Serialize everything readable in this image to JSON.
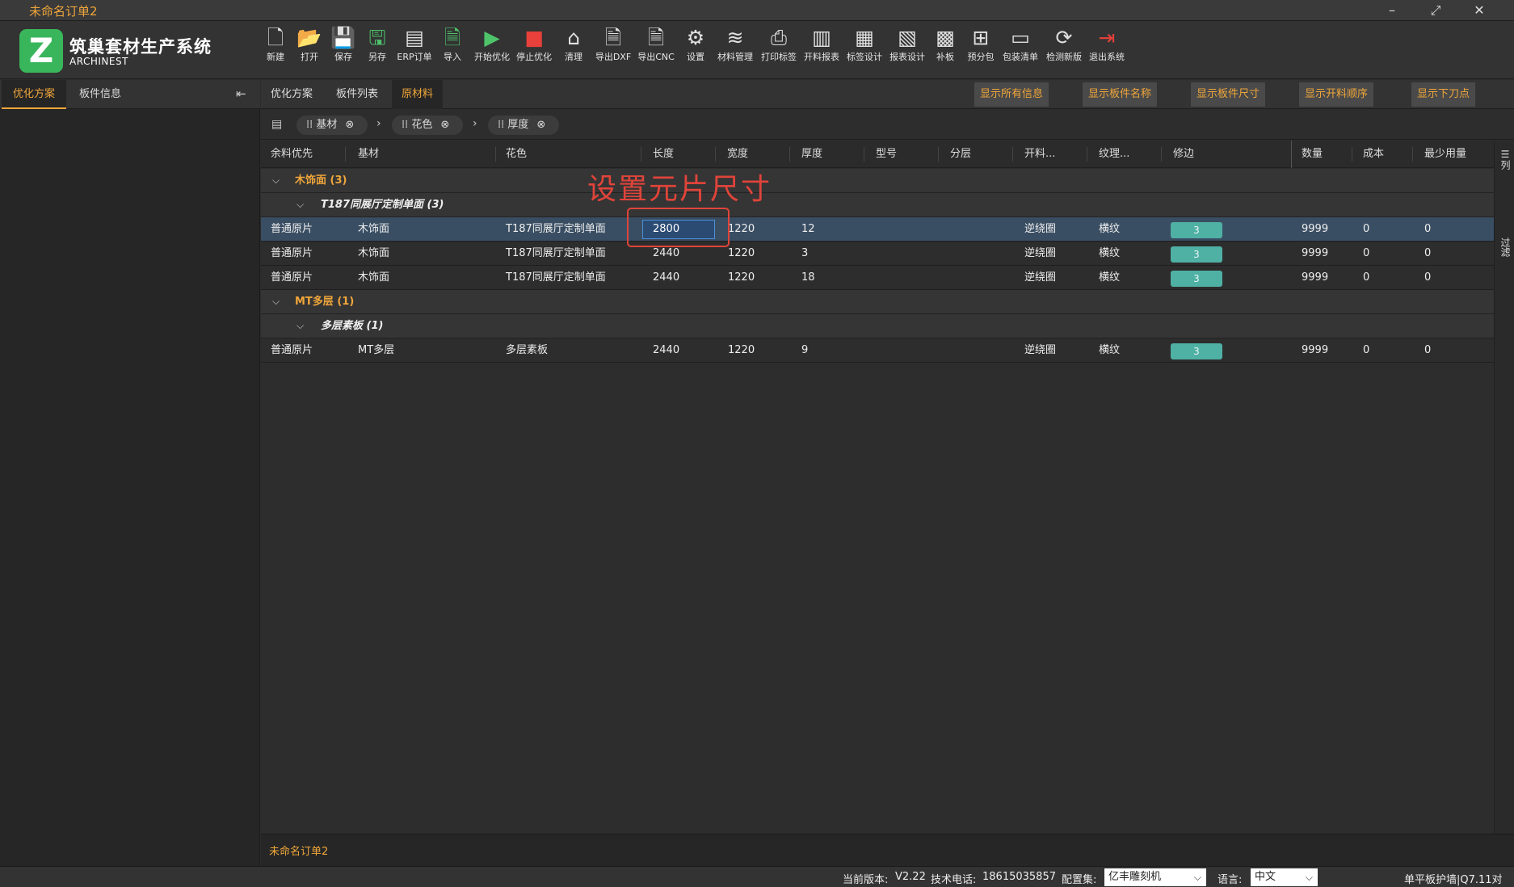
{
  "window": {
    "title": "未命名订单2",
    "minimize_glyph": "–",
    "maximize_glyph": "⤢",
    "close_glyph": "✕"
  },
  "app": {
    "logo_letter": "Z",
    "name": "筑巢套材生产系统",
    "subtitle": "ARCHINEST",
    "brand_color": "#39b65b",
    "accent_color": "#f0a63a"
  },
  "toolbar": [
    {
      "label": "新建",
      "icon": "new-file-icon"
    },
    {
      "label": "打开",
      "icon": "open-folder-icon"
    },
    {
      "label": "保存",
      "icon": "save-icon"
    },
    {
      "label": "另存",
      "icon": "save-as-icon"
    },
    {
      "label": "ERP订单",
      "icon": "erp-order-icon"
    },
    {
      "label": "导入",
      "icon": "import-xml-icon"
    },
    {
      "label": "开始优化",
      "icon": "play-icon"
    },
    {
      "label": "停止优化",
      "icon": "stop-icon"
    },
    {
      "label": "清理",
      "icon": "broom-icon"
    },
    {
      "label": "导出DXF",
      "icon": "export-dxf-icon"
    },
    {
      "label": "导出CNC",
      "icon": "export-cnc-icon"
    },
    {
      "label": "设置",
      "icon": "gear-icon"
    },
    {
      "label": "材料管理",
      "icon": "layers-icon"
    },
    {
      "label": "打印标签",
      "icon": "printer-icon"
    },
    {
      "label": "开料报表",
      "icon": "report-chart-icon"
    },
    {
      "label": "标签设计",
      "icon": "barcode-icon"
    },
    {
      "label": "报表设计",
      "icon": "report-design-icon"
    },
    {
      "label": "补板",
      "icon": "patch-board-icon"
    },
    {
      "label": "预分包",
      "icon": "package-tree-icon"
    },
    {
      "label": "包装清单",
      "icon": "packing-list-icon"
    },
    {
      "label": "检测新版",
      "icon": "update-check-icon"
    },
    {
      "label": "退出系统",
      "icon": "exit-icon"
    }
  ],
  "left_tabs": [
    "优化方案",
    "板件信息"
  ],
  "collapse_glyph": "⇤",
  "right_tabs": [
    "优化方案",
    "板件列表",
    "原材料"
  ],
  "show_buttons": [
    "显示所有信息",
    "显示板件名称",
    "显示板件尺寸",
    "显示开料顺序",
    "显示下刀点"
  ],
  "group_by": [
    "基材",
    "花色",
    "厚度"
  ],
  "columns": [
    "余料优先",
    "基材",
    "花色",
    "长度",
    "宽度",
    "厚度",
    "型号",
    "分层",
    "开料...",
    "纹理...",
    "修边",
    "数量",
    "成本",
    "最少用量"
  ],
  "groups": [
    {
      "label": "木饰面 (3)",
      "sub": "T187同展厅定制单面 (3)"
    },
    {
      "label": "MT多层 (1)",
      "sub": "多层素板 (1)"
    }
  ],
  "rows": [
    {
      "priority": "普通原片",
      "base": "木饰面",
      "color": "T187同展厅定制单面",
      "length": "2800",
      "width": "1220",
      "thickness": "12",
      "model": "",
      "layer": "",
      "cut": "逆绕圈",
      "grain": "横纹",
      "trim": "3",
      "qty": "9999",
      "cost": "0",
      "min": "0"
    },
    {
      "priority": "普通原片",
      "base": "木饰面",
      "color": "T187同展厅定制单面",
      "length": "2440",
      "width": "1220",
      "thickness": "3",
      "model": "",
      "layer": "",
      "cut": "逆绕圈",
      "grain": "横纹",
      "trim": "3",
      "qty": "9999",
      "cost": "0",
      "min": "0"
    },
    {
      "priority": "普通原片",
      "base": "木饰面",
      "color": "T187同展厅定制单面",
      "length": "2440",
      "width": "1220",
      "thickness": "18",
      "model": "",
      "layer": "",
      "cut": "逆绕圈",
      "grain": "横纹",
      "trim": "3",
      "qty": "9999",
      "cost": "0",
      "min": "0"
    },
    {
      "priority": "普通原片",
      "base": "MT多层",
      "color": "多层素板",
      "length": "2440",
      "width": "1220",
      "thickness": "9",
      "model": "",
      "layer": "",
      "cut": "逆绕圈",
      "grain": "横纹",
      "trim": "3",
      "qty": "9999",
      "cost": "0",
      "min": "0"
    }
  ],
  "annotation": "设置元片尺寸",
  "side_buttons": [
    "列",
    "过滤"
  ],
  "doc_name": "未命名订单2",
  "status": {
    "version_label": "当前版本:",
    "version": "V2.22",
    "phone_label": "技术电话:",
    "phone": "18615035857",
    "config_label": "配置集:",
    "config_value": "亿丰雕刻机",
    "lang_label": "语言:",
    "lang_value": "中文",
    "right_text": "单平板护墙|Q7.11对"
  }
}
